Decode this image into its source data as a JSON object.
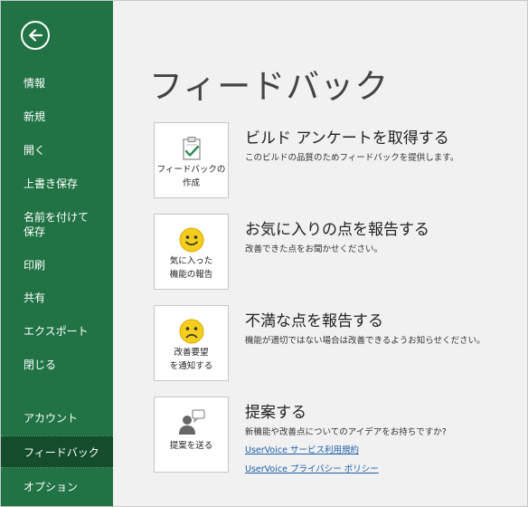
{
  "sidebar": {
    "back_icon": "arrow-left-circle-icon",
    "items": [
      {
        "label": "情報"
      },
      {
        "label": "新規"
      },
      {
        "label": "開く"
      },
      {
        "label": "上書き保存"
      },
      {
        "label": "名前を付けて\n保存"
      },
      {
        "label": "印刷"
      },
      {
        "label": "共有"
      },
      {
        "label": "エクスポート"
      },
      {
        "label": "閉じる"
      },
      {
        "label": "アカウント"
      },
      {
        "label": "フィードバック"
      },
      {
        "label": "オプション"
      }
    ],
    "active_index": 10,
    "color": "#217346"
  },
  "main": {
    "title": "フィードバック",
    "sections": [
      {
        "card_label": "フィードバックの\n作成",
        "icon": "clipboard-check-icon",
        "title": "ビルド アンケートを取得する",
        "description": "このビルドの品質のためフィードバックを提供します。"
      },
      {
        "card_label": "気に入った\n機能の報告",
        "icon": "smile-face-icon",
        "title": "お気に入りの点を報告する",
        "description": "改善できた点をお聞かせください。"
      },
      {
        "card_label": "改善要望\nを通知する",
        "icon": "frown-face-icon",
        "title": "不満な点を報告する",
        "description": "機能が適切ではない場合は改善できるようお知らせください。"
      },
      {
        "card_label": "提案を送る",
        "icon": "person-speech-bubble-icon",
        "title": "提案する",
        "description": "新機能や改善点についてのアイデアをお持ちですか?"
      }
    ],
    "links": [
      "UserVoice サービス利用規約",
      "UserVoice プライバシー ポリシー"
    ],
    "link_color": "#1f5fa8",
    "smiley_color": "#f5cd1c"
  }
}
